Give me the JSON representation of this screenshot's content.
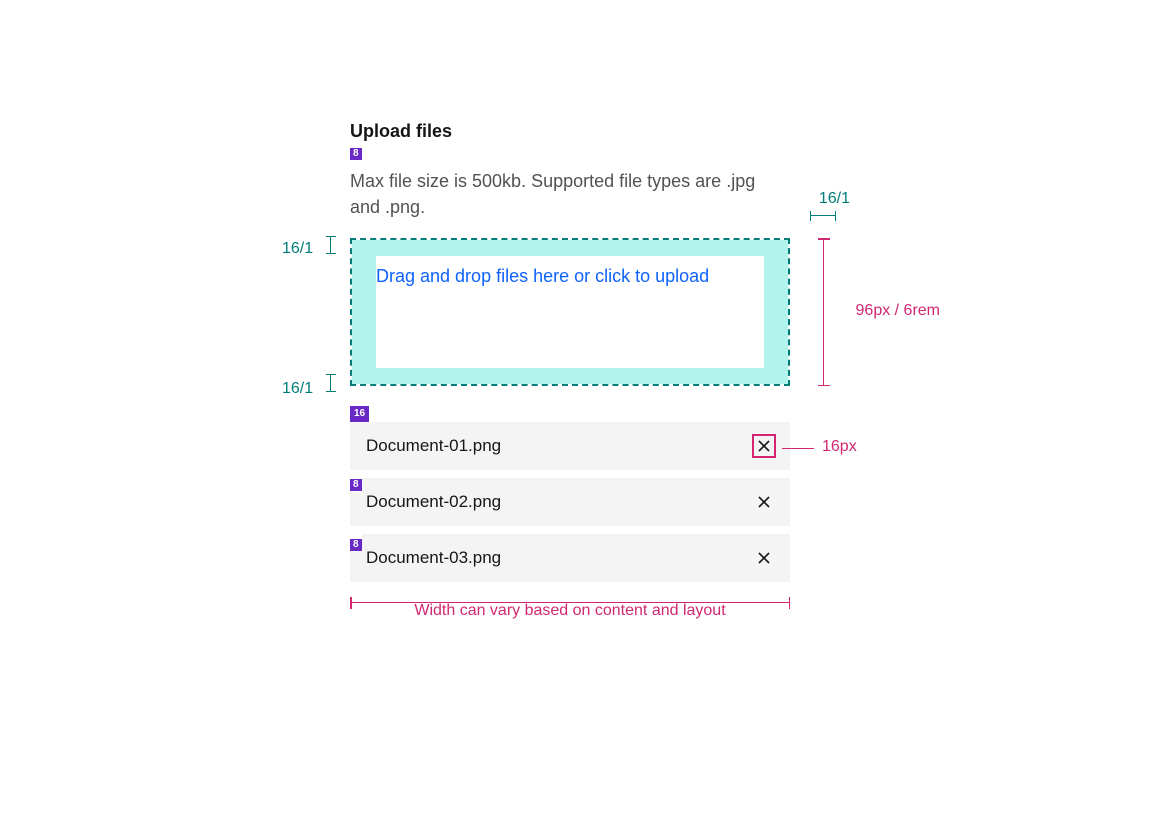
{
  "heading": "Upload files",
  "description": "Max file size is 500kb. Supported file types are .jpg and .png.",
  "dropzone": {
    "label": "Drag and drop files here or click to upload"
  },
  "spacing": {
    "gap_small": "8",
    "gap_large": "16",
    "padding_label": "16/1",
    "dropzone_height": "96px / 6rem",
    "close_icon_size": "16px",
    "width_note": "Width can vary based on content and layout"
  },
  "files": [
    {
      "name": "Document-01.png"
    },
    {
      "name": "Document-02.png"
    },
    {
      "name": "Document-03.png"
    }
  ]
}
